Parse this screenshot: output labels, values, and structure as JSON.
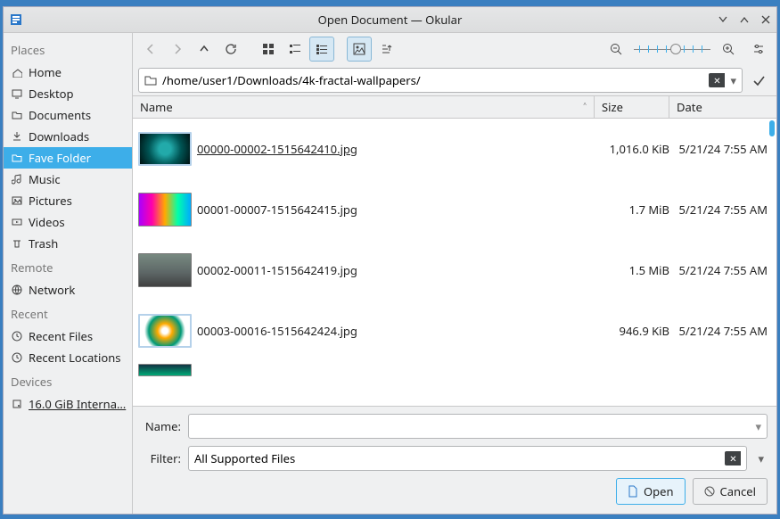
{
  "window": {
    "title": "Open Document — Okular"
  },
  "path": "/home/user1/Downloads/4k-fractal-wallpapers/",
  "sidebar": {
    "places": {
      "header": "Places",
      "items": [
        {
          "icon": "home",
          "label": "Home"
        },
        {
          "icon": "desktop",
          "label": "Desktop"
        },
        {
          "icon": "folder",
          "label": "Documents"
        },
        {
          "icon": "download",
          "label": "Downloads"
        },
        {
          "icon": "folder",
          "label": "Fave Folder",
          "selected": true
        },
        {
          "icon": "music",
          "label": "Music"
        },
        {
          "icon": "image",
          "label": "Pictures"
        },
        {
          "icon": "video",
          "label": "Videos"
        },
        {
          "icon": "trash",
          "label": "Trash"
        }
      ]
    },
    "remote": {
      "header": "Remote",
      "items": [
        {
          "icon": "network",
          "label": "Network"
        }
      ]
    },
    "recent": {
      "header": "Recent",
      "items": [
        {
          "icon": "clock",
          "label": "Recent Files"
        },
        {
          "icon": "clock",
          "label": "Recent Locations"
        }
      ]
    },
    "devices": {
      "header": "Devices",
      "items": [
        {
          "icon": "disk",
          "label": "16.0 GiB Interna…",
          "underlined": true
        }
      ]
    }
  },
  "columns": {
    "name": "Name",
    "size": "Size",
    "date": "Date"
  },
  "files": [
    {
      "name": "00000-00002-1515642410.jpg",
      "size": "1,016.0 KiB",
      "date": "5/21/24 7:55 AM",
      "selected": true
    },
    {
      "name": "00001-00007-1515642415.jpg",
      "size": "1.7 MiB",
      "date": "5/21/24 7:55 AM"
    },
    {
      "name": "00002-00011-1515642419.jpg",
      "size": "1.5 MiB",
      "date": "5/21/24 7:55 AM"
    },
    {
      "name": "00003-00016-1515642424.jpg",
      "size": "946.9 KiB",
      "date": "5/21/24 7:55 AM"
    },
    {
      "name": "",
      "size": "",
      "date": ""
    }
  ],
  "form": {
    "name_label": "Name:",
    "name_value": "",
    "filter_label": "Filter:",
    "filter_value": "All Supported Files"
  },
  "buttons": {
    "open": "Open",
    "cancel": "Cancel"
  }
}
